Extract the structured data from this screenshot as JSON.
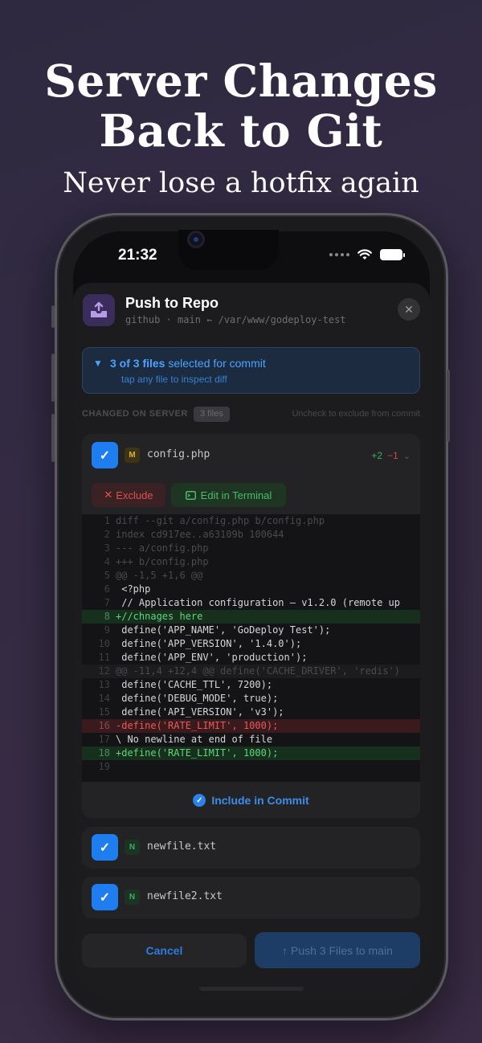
{
  "hero": {
    "title_line1": "Server Changes",
    "title_line2": "Back to Git",
    "subtitle": "Never lose a hotfix again"
  },
  "status_bar": {
    "time": "21:32"
  },
  "sheet": {
    "title": "Push to Repo",
    "subtitle": "github · main ← /var/www/godeploy-test",
    "close_icon": "close-icon"
  },
  "banner": {
    "count_text": "3 of 3 files",
    "suffix": " selected for commit",
    "hint": "tap any file to inspect diff"
  },
  "section": {
    "label": "CHANGED ON SERVER",
    "count": "3 files",
    "hint": "Uncheck to exclude from commit"
  },
  "files": [
    {
      "name": "config.php",
      "badge": "M",
      "additions": "+2",
      "deletions": "−1"
    },
    {
      "name": "newfile.txt",
      "badge": "N"
    },
    {
      "name": "newfile2.txt",
      "badge": "N"
    }
  ],
  "actions": {
    "exclude": "Exclude",
    "terminal": "Edit in Terminal",
    "include": "Include in Commit"
  },
  "diff": [
    {
      "n": "1",
      "type": "meta",
      "text": "diff --git a/config.php b/config.php"
    },
    {
      "n": "2",
      "type": "meta",
      "text": "index cd917ee..a63109b 100644"
    },
    {
      "n": "3",
      "type": "meta",
      "text": "--- a/config.php"
    },
    {
      "n": "4",
      "type": "meta",
      "text": "+++ b/config.php"
    },
    {
      "n": "5",
      "type": "meta",
      "text": "@@ -1,5 +1,6 @@"
    },
    {
      "n": "6",
      "type": "context",
      "text": " <?php"
    },
    {
      "n": "7",
      "type": "context",
      "text": " // Application configuration — v1.2.0 (remote up"
    },
    {
      "n": "8",
      "type": "added",
      "text": "+//chnages here"
    },
    {
      "n": "9",
      "type": "context",
      "text": " define('APP_NAME', 'GoDeploy Test');"
    },
    {
      "n": "10",
      "type": "context",
      "text": " define('APP_VERSION', '1.4.0');"
    },
    {
      "n": "11",
      "type": "context",
      "text": " define('APP_ENV', 'production');"
    },
    {
      "n": "12",
      "type": "hunk",
      "text": "@@ -11,4 +12,4 @@ define('CACHE_DRIVER', 'redis')"
    },
    {
      "n": "13",
      "type": "context",
      "text": " define('CACHE_TTL', 7200);"
    },
    {
      "n": "14",
      "type": "context",
      "text": " define('DEBUG_MODE', true);"
    },
    {
      "n": "15",
      "type": "context",
      "text": " define('API_VERSION', 'v3');"
    },
    {
      "n": "16",
      "type": "removed",
      "text": "-define('RATE_LIMIT', 1000);"
    },
    {
      "n": "17",
      "type": "context",
      "text": "\\ No newline at end of file"
    },
    {
      "n": "18",
      "type": "added",
      "text": "+define('RATE_LIMIT', 1000);"
    },
    {
      "n": "19",
      "type": "context",
      "text": ""
    }
  ],
  "footer": {
    "cancel": "Cancel",
    "push": "↑ Push 3 Files to main"
  },
  "colors": {
    "accent": "#1e7ef0",
    "added": "#62d47c",
    "removed": "#e85a5a",
    "background": "#2e2940"
  }
}
